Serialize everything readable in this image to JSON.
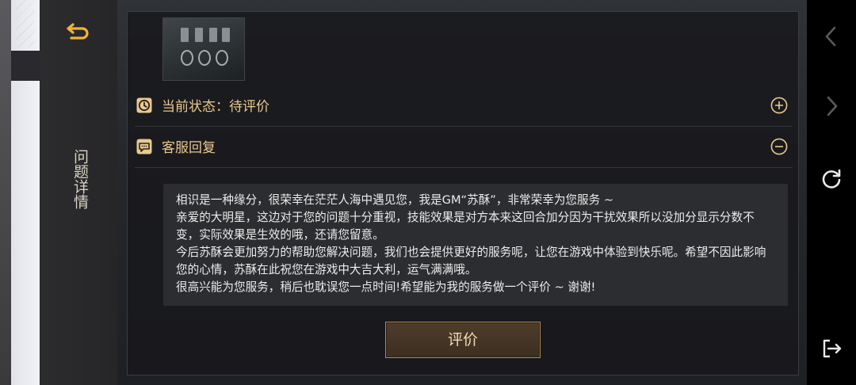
{
  "sidebar": {
    "title": "问题详情",
    "back_icon": "back-arrow-icon"
  },
  "status_row": {
    "label": "当前状态：待评价",
    "icon": "clock-icon",
    "toggle_icon": "plus-circle-icon"
  },
  "reply_row": {
    "label": "客服回复",
    "icon": "chat-bubble-icon",
    "toggle_icon": "minus-circle-icon"
  },
  "reply": {
    "lines": [
      "相识是一种缘分，很荣幸在茫茫人海中遇见您，我是GM“苏酥”，非常荣幸为您服务 ~",
      "亲爱的大明星，这边对于您的问题十分重视，技能效果是对方本来这回合加分因为干扰效果所以没加分显示分数不变，实际效果是生效的哦，还请您留意。",
      "今后苏酥会更加努力的帮助您解决问题，我们也会提供更好的服务呢，让您在游戏中体验到快乐呢。希望不因此影响您的心情，苏酥在此祝您在游戏中大吉大利，运气满满哦。",
      "很高兴能为您服务，稍后也耽误您一点时间!希望能为我的服务做一个评价 ~ 谢谢!"
    ]
  },
  "rate_button": {
    "label": "评价"
  },
  "system_nav": {
    "icons": [
      "chevron-left-icon",
      "chevron-right-icon",
      "refresh-icon",
      "exit-icon"
    ]
  },
  "colors": {
    "accent": "#e8c98f",
    "text": "#ececec",
    "button_border": "#b08a56",
    "icon_gold": "#f0b43a"
  }
}
